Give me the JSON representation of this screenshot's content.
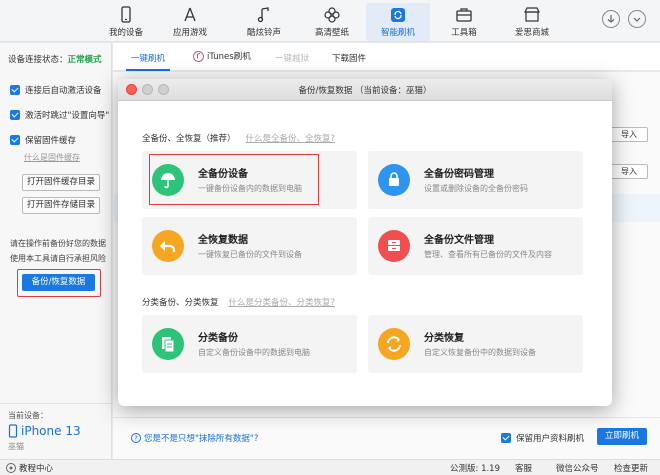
{
  "nav": {
    "items": [
      {
        "label": "我的设备",
        "icon": "phone-icon"
      },
      {
        "label": "应用游戏",
        "icon": "app-store-icon"
      },
      {
        "label": "酷炫铃声",
        "icon": "music-note-icon"
      },
      {
        "label": "高清壁纸",
        "icon": "flower-icon"
      },
      {
        "label": "智能刷机",
        "icon": "refresh-icon"
      },
      {
        "label": "工具箱",
        "icon": "toolbox-icon"
      },
      {
        "label": "爱思商城",
        "icon": "store-icon"
      }
    ],
    "active_index": 4
  },
  "sidebar": {
    "conn_label": "设备连接状态：",
    "conn_mode": "正常模式",
    "options": [
      {
        "label": "连接后自动激活设备"
      },
      {
        "label": "激活时跳过\"设置向导\""
      },
      {
        "label": "保留固件缓存"
      }
    ],
    "what_cache_link": "什么是固件缓存",
    "open_cache_btn": "打开固件缓存目录",
    "open_store_btn": "打开固件存储目录",
    "note_line1": "请在操作前备份好您的数据",
    "note_line2": "使用本工具请自行承担风险",
    "backup_btn": "备份/恢复数据",
    "device_label": "当前设备：",
    "device_name": "iPhone 13",
    "device_sub": "巫猫"
  },
  "tabs": [
    {
      "label": "一键刷机",
      "state": "active"
    },
    {
      "label": "iTunes刷机",
      "state": "normal"
    },
    {
      "label": "一键越狱",
      "state": "disabled"
    },
    {
      "label": "下载固件",
      "state": "normal"
    }
  ],
  "main": {
    "import_label": "导入",
    "erase_link": "您是不是只想\"抹除所有数据\"?",
    "keep_data_label": "保留用户资料刷机",
    "flash_btn": "立即刷机"
  },
  "modal": {
    "title": "备份/恢复数据 （当前设备：巫猫）",
    "section1": {
      "title": "全备份、全恢复（推荐）",
      "link": "什么是全备份、全恢复?"
    },
    "section2": {
      "title": "分类备份、分类恢复",
      "link": "什么是分类备份、分类恢复?"
    },
    "cards": [
      {
        "title": "全备份设备",
        "subtitle": "一键备份设备内的数据到电脑",
        "icon": "umbrella-icon",
        "color": "#2dc47a"
      },
      {
        "title": "全备份密码管理",
        "subtitle": "设置或删除设备的全备份密码",
        "icon": "lock-icon",
        "color": "#2f94ee"
      },
      {
        "title": "全恢复数据",
        "subtitle": "一键恢复已备份的文件到设备",
        "icon": "undo-arrow-icon",
        "color": "#f5a623"
      },
      {
        "title": "全备份文件管理",
        "subtitle": "管理、查看所有已备份的文件及内容",
        "icon": "file-cabinet-icon",
        "color": "#ef4f4f"
      },
      {
        "title": "分类备份",
        "subtitle": "自定义备份设备中的数据到电脑",
        "icon": "documents-icon",
        "color": "#2dc47a"
      },
      {
        "title": "分类恢复",
        "subtitle": "自定义恢复备份中的数据到设备",
        "icon": "restore-cycle-icon",
        "color": "#f5a623"
      }
    ]
  },
  "status": {
    "tutorial": "教程中心",
    "beta_version": "公测版: 1.19",
    "service": "客服",
    "wechat": "微信公众号",
    "update": "检查更新"
  }
}
